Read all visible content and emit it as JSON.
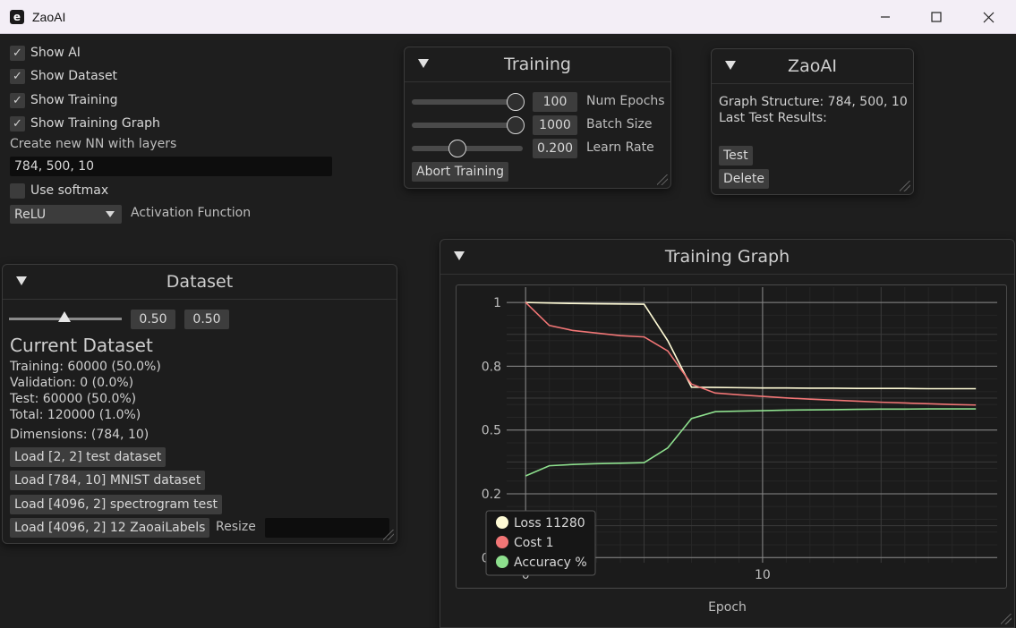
{
  "window": {
    "title": "ZaoAI",
    "icon_letter": "e"
  },
  "main": {
    "checkboxes": [
      {
        "label": "Show AI",
        "checked": true
      },
      {
        "label": "Show Dataset",
        "checked": true
      },
      {
        "label": "Show Training",
        "checked": true
      },
      {
        "label": "Show Training Graph",
        "checked": true
      }
    ],
    "nn_label": "Create new NN with layers",
    "nn_value": "784, 500, 10",
    "softmax": {
      "label": "Use softmax",
      "checked": false
    },
    "activation": {
      "selected": "ReLU",
      "label": "Activation Function"
    }
  },
  "training": {
    "title": "Training",
    "rows": [
      {
        "value": "100",
        "label": "Num Epochs",
        "fraction": 1.0
      },
      {
        "value": "1000",
        "label": "Batch Size",
        "fraction": 1.0
      },
      {
        "value": "0.200",
        "label": "Learn Rate",
        "fraction": 0.4
      }
    ],
    "abort_label": "Abort Training"
  },
  "ai": {
    "title": "ZaoAI",
    "structure": "Graph Structure: 784, 500, 10",
    "last_results": "Last Test Results:",
    "test_label": "Test",
    "delete_label": "Delete"
  },
  "dataset": {
    "title": "Dataset",
    "split_fraction": 0.5,
    "split_value1": "0.50",
    "split_value2": "0.50",
    "heading": "Current Dataset",
    "stats": [
      "Training: 60000 (50.0%)",
      "Validation: 0 (0.0%)",
      "Test: 60000 (50.0%)",
      "Total: 120000 (1.0%)"
    ],
    "dimensions": "Dimensions: (784, 10)",
    "load_buttons": [
      "Load [2, 2] test dataset",
      "Load [784, 10] MNIST dataset",
      "Load [4096, 2] spectrogram test",
      "Load [4096, 2] 12 ZaoaiLabels"
    ],
    "resize_label": "Resize",
    "resize_value": ""
  },
  "graph": {
    "title": "Training Graph"
  },
  "chart_data": {
    "type": "line",
    "xlabel": "Epoch",
    "ylabel": "",
    "xlim": [
      -0.8,
      19.9
    ],
    "ylim": [
      -0.02,
      1.06
    ],
    "xticks": [
      0,
      10
    ],
    "yticks": [
      {
        "v": 0.0,
        "label": "0.0"
      },
      {
        "v": 0.25,
        "label": "0.2"
      },
      {
        "v": 0.5,
        "label": "0.5"
      },
      {
        "v": 0.75,
        "label": "0.8"
      },
      {
        "v": 1.0,
        "label": "1"
      }
    ],
    "legend_position": "bottom-left",
    "series": [
      {
        "name": "Loss 11280",
        "color": "#fffbd6",
        "x": [
          0,
          1,
          2,
          3,
          4,
          5,
          6,
          7,
          8,
          9,
          10,
          11,
          12,
          13,
          14,
          15,
          16,
          17,
          18,
          19
        ],
        "y": [
          1.0,
          0.998,
          0.996,
          0.995,
          0.994,
          0.993,
          0.85,
          0.668,
          0.667,
          0.666,
          0.665,
          0.665,
          0.664,
          0.664,
          0.663,
          0.663,
          0.663,
          0.662,
          0.662,
          0.662
        ]
      },
      {
        "name": "Cost 1",
        "color": "#f27676",
        "x": [
          0,
          1,
          2,
          3,
          4,
          5,
          6,
          7,
          8,
          9,
          10,
          11,
          12,
          13,
          14,
          15,
          16,
          17,
          18,
          19
        ],
        "y": [
          1.0,
          0.91,
          0.89,
          0.88,
          0.87,
          0.865,
          0.81,
          0.68,
          0.645,
          0.638,
          0.632,
          0.626,
          0.621,
          0.617,
          0.613,
          0.609,
          0.606,
          0.603,
          0.6,
          0.598
        ]
      },
      {
        "name": "Accuracy %",
        "color": "#8ee08e",
        "x": [
          0,
          1,
          2,
          3,
          4,
          5,
          6,
          7,
          8,
          9,
          10,
          11,
          12,
          13,
          14,
          15,
          16,
          17,
          18,
          19
        ],
        "y": [
          0.32,
          0.36,
          0.365,
          0.368,
          0.37,
          0.372,
          0.43,
          0.545,
          0.572,
          0.574,
          0.576,
          0.578,
          0.579,
          0.58,
          0.581,
          0.582,
          0.582,
          0.583,
          0.583,
          0.583
        ]
      }
    ]
  }
}
